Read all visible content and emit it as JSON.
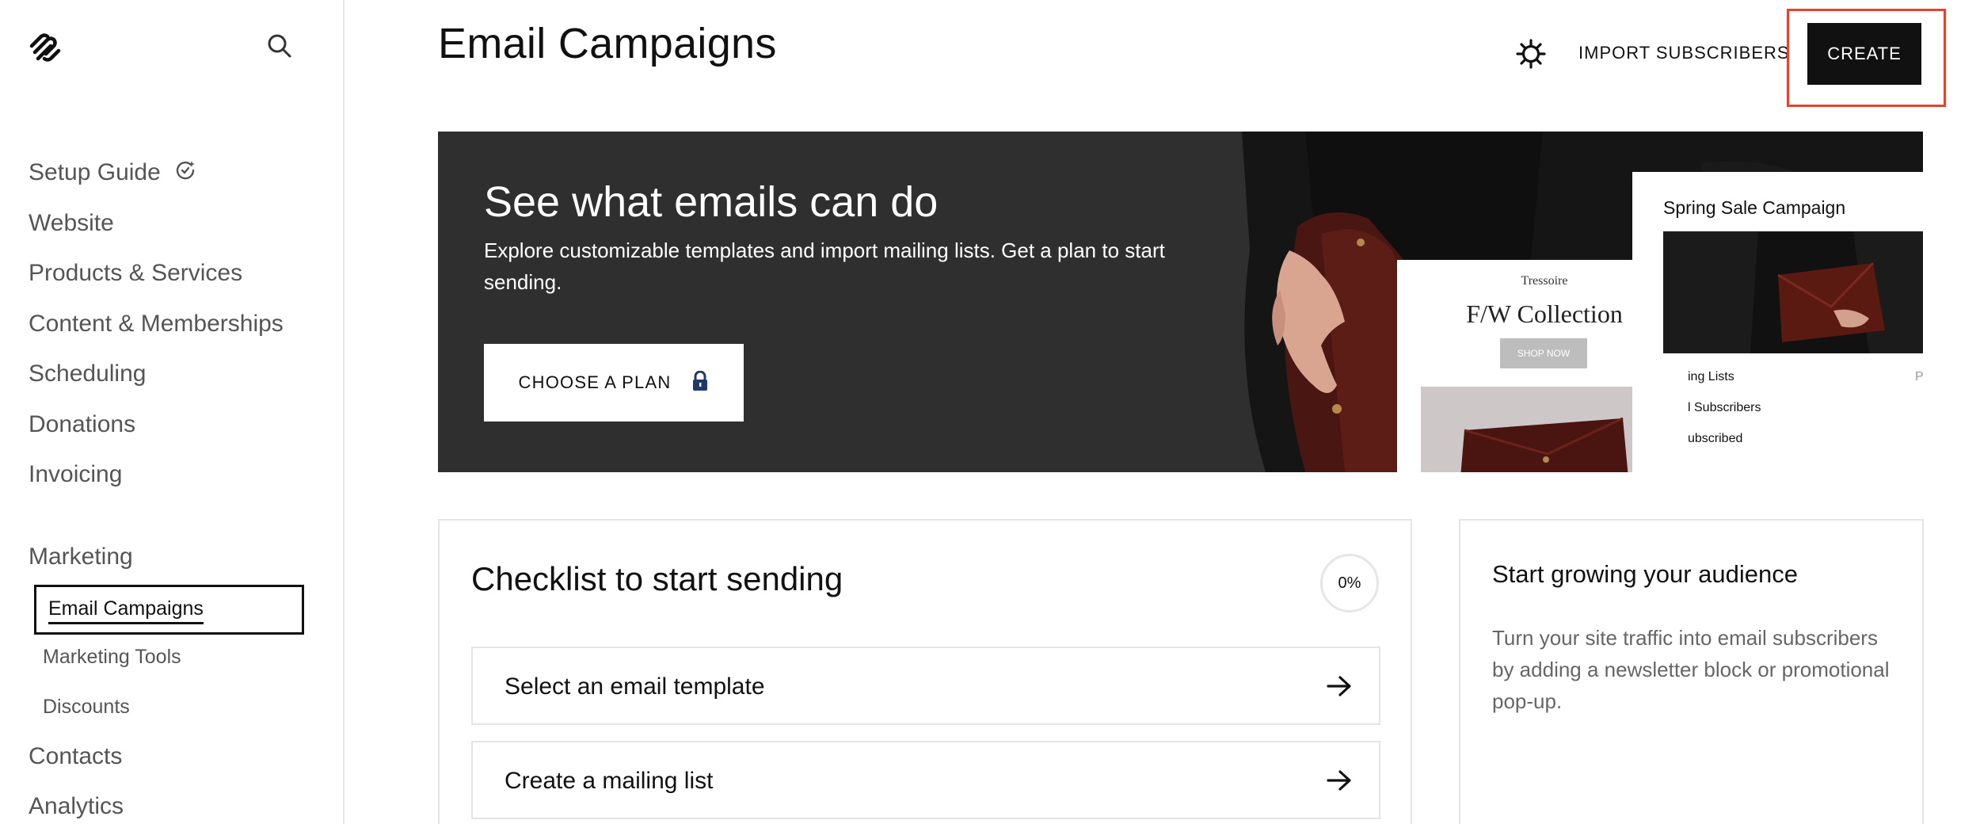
{
  "header": {
    "title": "Email Campaigns",
    "import_label": "IMPORT SUBSCRIBERS",
    "create_label": "CREATE"
  },
  "sidebar": {
    "items": [
      {
        "label": "Setup Guide"
      },
      {
        "label": "Website"
      },
      {
        "label": "Products & Services"
      },
      {
        "label": "Content & Memberships"
      },
      {
        "label": "Scheduling"
      },
      {
        "label": "Donations"
      },
      {
        "label": "Invoicing"
      },
      {
        "label": "Marketing"
      },
      {
        "label": "Contacts"
      },
      {
        "label": "Analytics"
      }
    ],
    "marketing_sub": [
      {
        "label": "Email Campaigns",
        "active": true
      },
      {
        "label": "Marketing Tools"
      },
      {
        "label": "Discounts"
      }
    ]
  },
  "banner": {
    "title": "See what emails can do",
    "text": "Explore customizable templates and import mailing lists. Get a plan to start sending.",
    "button_label": "CHOOSE A PLAN",
    "preview_fw": {
      "brand": "Tressoire",
      "title": "F/W Collection",
      "shop": "SHOP NOW"
    },
    "preview_spring": {
      "title": "Spring Sale Campaign",
      "rows": [
        "ing Lists",
        "l Subscribers",
        "ubscribed"
      ],
      "row_right": "P"
    }
  },
  "checklist": {
    "title": "Checklist to start sending",
    "progress": "0%",
    "items": [
      {
        "label": "Select an email template"
      },
      {
        "label": "Create a mailing list"
      }
    ]
  },
  "audience": {
    "title": "Start growing your audience",
    "text": "Turn your site traffic into email subscribers by adding a newsletter block or promotional pop-up."
  },
  "colors": {
    "accent_outline": "#e0452f",
    "banner_bg": "#2f2f2f",
    "primary_button": "#111111"
  }
}
